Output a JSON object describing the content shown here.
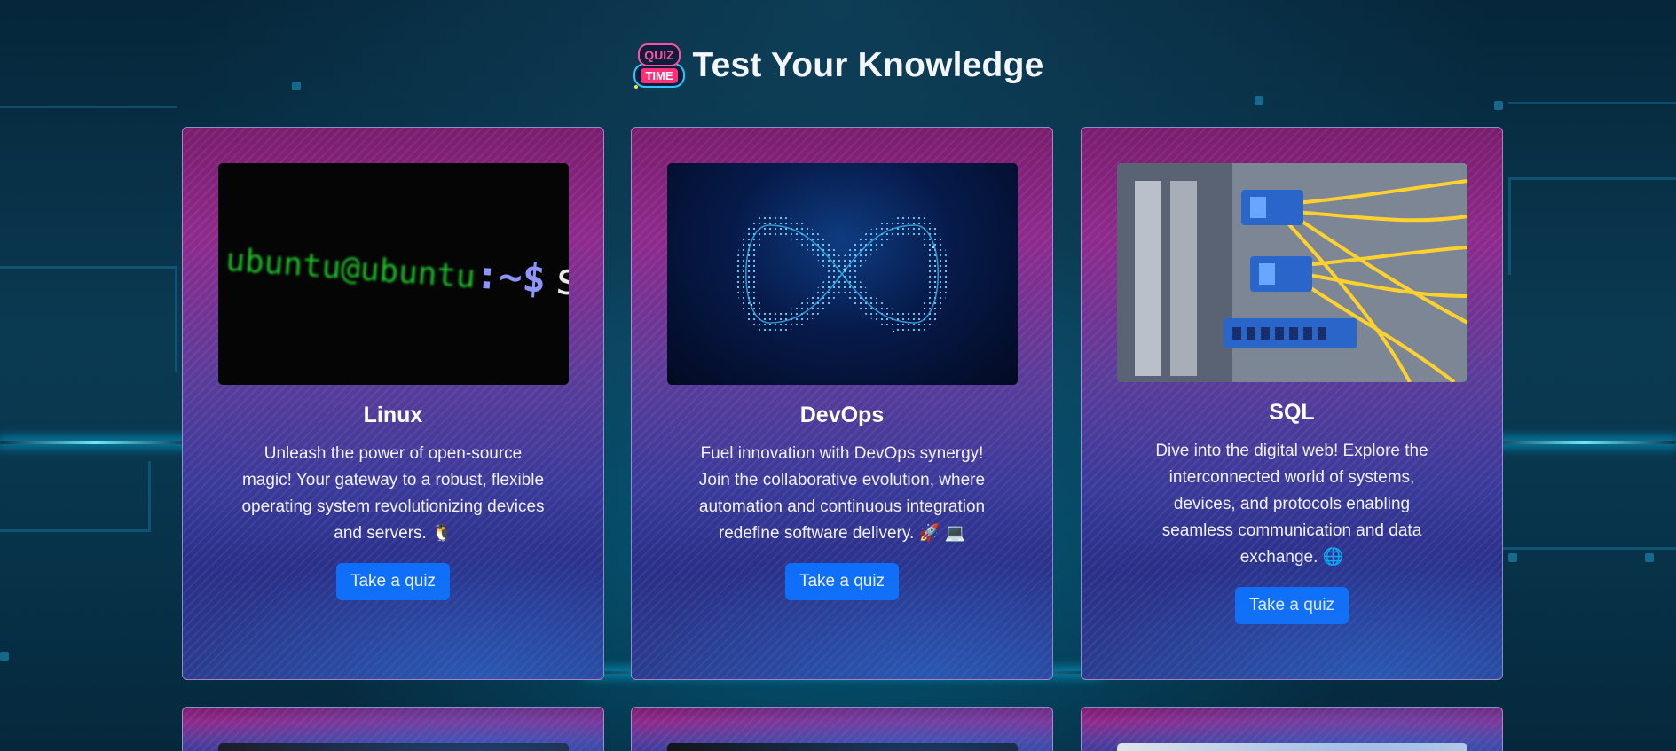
{
  "header": {
    "logo_line1": "QUIZ",
    "logo_line2": "TIME",
    "title": "Test Your Knowledge"
  },
  "cards": [
    {
      "title": "Linux",
      "description": "Unleash the power of open-source magic! Your gateway to a robust, flexible operating system revolutionizing devices and servers. 🐧",
      "button_label": "Take a quiz",
      "image": {
        "prompt": "ubuntu@ubuntu",
        "separator": ":~$",
        "command": "sudo"
      }
    },
    {
      "title": "DevOps",
      "description": "Fuel innovation with DevOps synergy! Join the collaborative evolution, where automation and continuous integration redefine software delivery. 🚀 💻",
      "button_label": "Take a quiz",
      "image": {
        "icon": "infinity-icon"
      }
    },
    {
      "title": "SQL",
      "description": "Dive into the digital web! Explore the interconnected world of systems, devices, and protocols enabling seamless communication and data exchange. 🌐",
      "button_label": "Take a quiz",
      "image": {
        "icon": "network-cables-icon"
      }
    }
  ],
  "colors": {
    "button": "#0d6efd",
    "background": "#0a3a52",
    "card_top": "#8e2a8c",
    "card_bottom": "#2b3d8f"
  }
}
